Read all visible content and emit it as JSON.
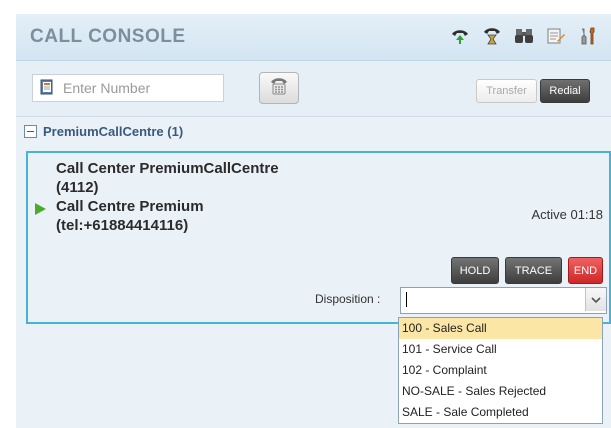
{
  "header": {
    "title": "CALL CONSOLE",
    "icons": [
      "phone-available-icon",
      "phone-busy-icon",
      "binoculars-icon",
      "notepad-icon",
      "settings-icon"
    ]
  },
  "toolbar": {
    "number_placeholder": "Enter Number",
    "number_value": "",
    "transfer_label": "Transfer",
    "redial_label": "Redial"
  },
  "call_group": {
    "label": "PremiumCallCentre (1)"
  },
  "active_call": {
    "line1": "Call Center PremiumCallCentre",
    "line2": "(4112)",
    "line3": "Call Centre Premium",
    "line4": "(tel:+61884414116)",
    "status": "Active 01:18",
    "hold_label": "HOLD",
    "trace_label": "TRACE",
    "end_label": "END",
    "disposition_label": "Disposition :",
    "disposition_value": ""
  },
  "disposition_options": [
    "100 - Sales Call",
    "101 - Service Call",
    "102 - Complaint",
    "NO-SALE - Sales Rejected",
    "SALE - Sale Completed"
  ],
  "highlighted_option_index": 0,
  "colors": {
    "panel_border": "#48b3d6",
    "end_button": "#d93a3a",
    "highlight": "#fbe6a6",
    "active_indicator": "#4bab2d"
  }
}
